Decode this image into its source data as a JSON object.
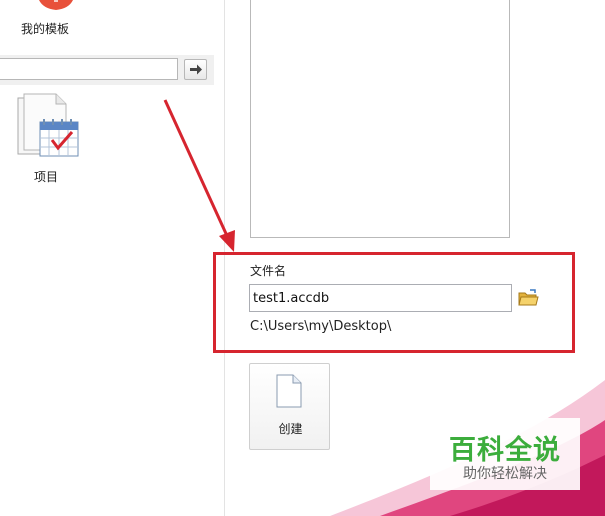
{
  "left_pane": {
    "my_templates_label": "我的模板",
    "search": {
      "value": "",
      "placeholder": ""
    },
    "templates": [
      {
        "label": "项目",
        "icon": "calendar-document-icon"
      }
    ]
  },
  "file_section": {
    "filename_label": "文件名",
    "filename_value": "test1.accdb",
    "path": "C:\\Users\\my\\Desktop\\",
    "create_label": "创建"
  },
  "watermark": {
    "title": "百科全说",
    "subtitle": "助你轻松解决"
  },
  "colors": {
    "annotation_red": "#d6252f",
    "accent_pink": "#d81b60",
    "watermark_green": "#3cad3c"
  }
}
